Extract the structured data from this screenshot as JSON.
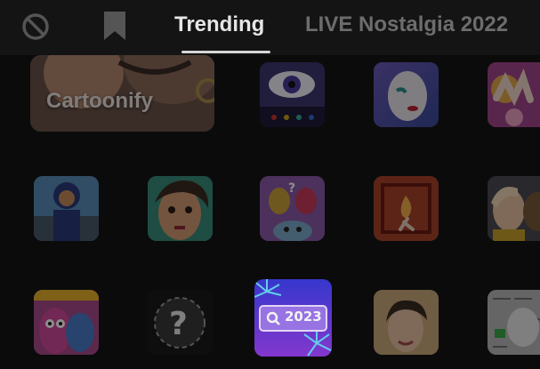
{
  "tabs": {
    "none_icon": "block-icon",
    "saved_icon": "bookmark-icon",
    "items": [
      {
        "label": "Trending",
        "active": true
      },
      {
        "label": "LIVE Nostalgia 2022",
        "active": false
      }
    ]
  },
  "effects": {
    "featured_label": "Cartoonify",
    "search_badge": "2023"
  },
  "colors": {
    "background": "#0b0b0b",
    "tab_active": "#e6e6e6",
    "tab_inactive": "#6d6d6d"
  }
}
